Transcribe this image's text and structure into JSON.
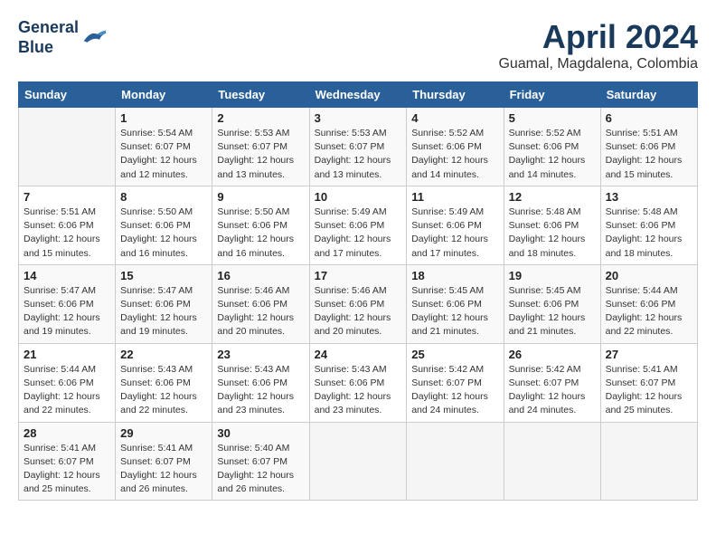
{
  "header": {
    "logo_line1": "General",
    "logo_line2": "Blue",
    "month": "April 2024",
    "location": "Guamal, Magdalena, Colombia"
  },
  "days_of_week": [
    "Sunday",
    "Monday",
    "Tuesday",
    "Wednesday",
    "Thursday",
    "Friday",
    "Saturday"
  ],
  "weeks": [
    [
      {
        "num": "",
        "empty": true
      },
      {
        "num": "1",
        "sunrise": "5:54 AM",
        "sunset": "6:07 PM",
        "daylight": "12 hours and 12 minutes."
      },
      {
        "num": "2",
        "sunrise": "5:53 AM",
        "sunset": "6:07 PM",
        "daylight": "12 hours and 13 minutes."
      },
      {
        "num": "3",
        "sunrise": "5:53 AM",
        "sunset": "6:07 PM",
        "daylight": "12 hours and 13 minutes."
      },
      {
        "num": "4",
        "sunrise": "5:52 AM",
        "sunset": "6:06 PM",
        "daylight": "12 hours and 14 minutes."
      },
      {
        "num": "5",
        "sunrise": "5:52 AM",
        "sunset": "6:06 PM",
        "daylight": "12 hours and 14 minutes."
      },
      {
        "num": "6",
        "sunrise": "5:51 AM",
        "sunset": "6:06 PM",
        "daylight": "12 hours and 15 minutes."
      }
    ],
    [
      {
        "num": "7",
        "sunrise": "5:51 AM",
        "sunset": "6:06 PM",
        "daylight": "12 hours and 15 minutes."
      },
      {
        "num": "8",
        "sunrise": "5:50 AM",
        "sunset": "6:06 PM",
        "daylight": "12 hours and 16 minutes."
      },
      {
        "num": "9",
        "sunrise": "5:50 AM",
        "sunset": "6:06 PM",
        "daylight": "12 hours and 16 minutes."
      },
      {
        "num": "10",
        "sunrise": "5:49 AM",
        "sunset": "6:06 PM",
        "daylight": "12 hours and 17 minutes."
      },
      {
        "num": "11",
        "sunrise": "5:49 AM",
        "sunset": "6:06 PM",
        "daylight": "12 hours and 17 minutes."
      },
      {
        "num": "12",
        "sunrise": "5:48 AM",
        "sunset": "6:06 PM",
        "daylight": "12 hours and 18 minutes."
      },
      {
        "num": "13",
        "sunrise": "5:48 AM",
        "sunset": "6:06 PM",
        "daylight": "12 hours and 18 minutes."
      }
    ],
    [
      {
        "num": "14",
        "sunrise": "5:47 AM",
        "sunset": "6:06 PM",
        "daylight": "12 hours and 19 minutes."
      },
      {
        "num": "15",
        "sunrise": "5:47 AM",
        "sunset": "6:06 PM",
        "daylight": "12 hours and 19 minutes."
      },
      {
        "num": "16",
        "sunrise": "5:46 AM",
        "sunset": "6:06 PM",
        "daylight": "12 hours and 20 minutes."
      },
      {
        "num": "17",
        "sunrise": "5:46 AM",
        "sunset": "6:06 PM",
        "daylight": "12 hours and 20 minutes."
      },
      {
        "num": "18",
        "sunrise": "5:45 AM",
        "sunset": "6:06 PM",
        "daylight": "12 hours and 21 minutes."
      },
      {
        "num": "19",
        "sunrise": "5:45 AM",
        "sunset": "6:06 PM",
        "daylight": "12 hours and 21 minutes."
      },
      {
        "num": "20",
        "sunrise": "5:44 AM",
        "sunset": "6:06 PM",
        "daylight": "12 hours and 22 minutes."
      }
    ],
    [
      {
        "num": "21",
        "sunrise": "5:44 AM",
        "sunset": "6:06 PM",
        "daylight": "12 hours and 22 minutes."
      },
      {
        "num": "22",
        "sunrise": "5:43 AM",
        "sunset": "6:06 PM",
        "daylight": "12 hours and 22 minutes."
      },
      {
        "num": "23",
        "sunrise": "5:43 AM",
        "sunset": "6:06 PM",
        "daylight": "12 hours and 23 minutes."
      },
      {
        "num": "24",
        "sunrise": "5:43 AM",
        "sunset": "6:06 PM",
        "daylight": "12 hours and 23 minutes."
      },
      {
        "num": "25",
        "sunrise": "5:42 AM",
        "sunset": "6:07 PM",
        "daylight": "12 hours and 24 minutes."
      },
      {
        "num": "26",
        "sunrise": "5:42 AM",
        "sunset": "6:07 PM",
        "daylight": "12 hours and 24 minutes."
      },
      {
        "num": "27",
        "sunrise": "5:41 AM",
        "sunset": "6:07 PM",
        "daylight": "12 hours and 25 minutes."
      }
    ],
    [
      {
        "num": "28",
        "sunrise": "5:41 AM",
        "sunset": "6:07 PM",
        "daylight": "12 hours and 25 minutes."
      },
      {
        "num": "29",
        "sunrise": "5:41 AM",
        "sunset": "6:07 PM",
        "daylight": "12 hours and 26 minutes."
      },
      {
        "num": "30",
        "sunrise": "5:40 AM",
        "sunset": "6:07 PM",
        "daylight": "12 hours and 26 minutes."
      },
      {
        "num": "",
        "empty": true
      },
      {
        "num": "",
        "empty": true
      },
      {
        "num": "",
        "empty": true
      },
      {
        "num": "",
        "empty": true
      }
    ]
  ]
}
